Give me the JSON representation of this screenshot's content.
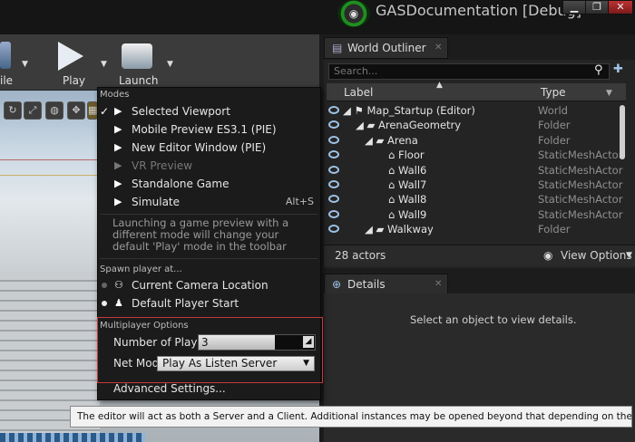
{
  "window": {
    "title": "GASDocumentation [Debug]",
    "buttons": [
      "▁",
      "❐",
      "✕"
    ]
  },
  "toolbar": {
    "items": [
      {
        "label": "ile"
      },
      {
        "label": "Play"
      },
      {
        "label": "Launch"
      }
    ]
  },
  "play_menu": {
    "modes_header": "Modes",
    "modes": [
      {
        "label": "Selected Viewport",
        "checked": true,
        "icon": "play-icon",
        "shortcut": ""
      },
      {
        "label": "Mobile Preview ES3.1 (PIE)",
        "checked": false,
        "icon": "mobile-preview-icon",
        "shortcut": ""
      },
      {
        "label": "New Editor Window (PIE)",
        "checked": false,
        "icon": "new-window-icon",
        "shortcut": ""
      },
      {
        "label": "VR Preview",
        "checked": false,
        "icon": "vr-icon",
        "shortcut": "",
        "disabled": true
      },
      {
        "label": "Standalone Game",
        "checked": false,
        "icon": "standalone-icon",
        "shortcut": ""
      },
      {
        "label": "Simulate",
        "checked": false,
        "icon": "simulate-icon",
        "shortcut": "Alt+S"
      }
    ],
    "description": "Launching a game preview with a different mode will change your default 'Play' mode in the toolbar",
    "spawn_header": "Spawn player at...",
    "spawn_options": [
      {
        "label": "Current Camera Location",
        "selected": false
      },
      {
        "label": "Default Player Start",
        "selected": true
      }
    ],
    "multiplayer_header": "Multiplayer Options",
    "num_players_label": "Number of Players",
    "num_players_value": "3",
    "net_mode_label": "Net Mode",
    "net_mode_value": "Play As Listen Server",
    "advanced_label": "Advanced Settings..."
  },
  "tooltip": "The editor will act as both a Server and a Client. Additional instances may be opened beyond that depending on the number of clients.",
  "world_outliner": {
    "tab_label": "World Outliner",
    "search_placeholder": "Search...",
    "columns": {
      "label": "Label",
      "type": "Type"
    },
    "rows": [
      {
        "label": "Map_Startup (Editor)",
        "type": "World",
        "depth": 0
      },
      {
        "label": "ArenaGeometry",
        "type": "Folder",
        "depth": 1
      },
      {
        "label": "Arena",
        "type": "Folder",
        "depth": 2
      },
      {
        "label": "Floor",
        "type": "StaticMeshActor",
        "depth": 3
      },
      {
        "label": "Wall6",
        "type": "StaticMeshActor",
        "depth": 3
      },
      {
        "label": "Wall7",
        "type": "StaticMeshActor",
        "depth": 3
      },
      {
        "label": "Wall8",
        "type": "StaticMeshActor",
        "depth": 3
      },
      {
        "label": "Wall9",
        "type": "StaticMeshActor",
        "depth": 3
      },
      {
        "label": "Walkway",
        "type": "Folder",
        "depth": 2
      }
    ],
    "actor_count": "28 actors",
    "view_options": "View Options"
  },
  "details": {
    "tab_label": "Details",
    "empty_message": "Select an object to view details."
  },
  "colors": {
    "highlight_border": "#c43a3a",
    "accent_green": "#1f8f1f"
  }
}
